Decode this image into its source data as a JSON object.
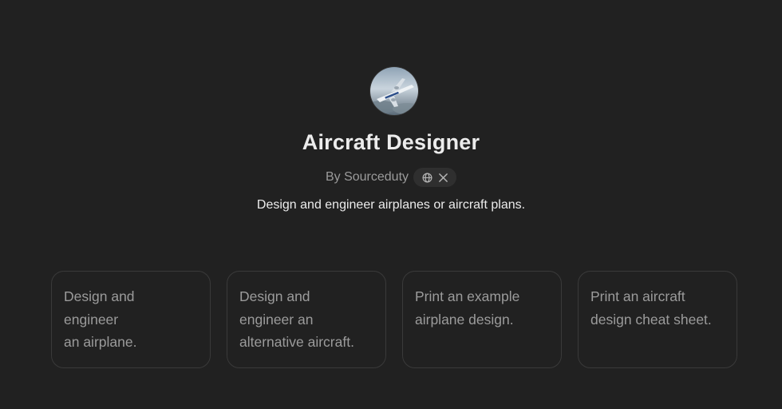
{
  "gpt": {
    "name": "Aircraft Designer",
    "byline": "By Sourceduty",
    "description": "Design and engineer airplanes or aircraft plans.",
    "social_icons": [
      "globe-icon",
      "x-icon"
    ]
  },
  "starters": [
    {
      "label": "Design and\nengineer\nan airplane."
    },
    {
      "label": "Design and\nengineer an\nalternative aircraft."
    },
    {
      "label": "Print an example\nairplane design."
    },
    {
      "label": "Print an aircraft\ndesign cheat sheet."
    }
  ],
  "colors": {
    "background": "#212121",
    "text_primary": "#ececec",
    "text_secondary": "#9b9b9b",
    "card_border": "#3a3a3a",
    "pill_bg": "#2f2f2f"
  }
}
